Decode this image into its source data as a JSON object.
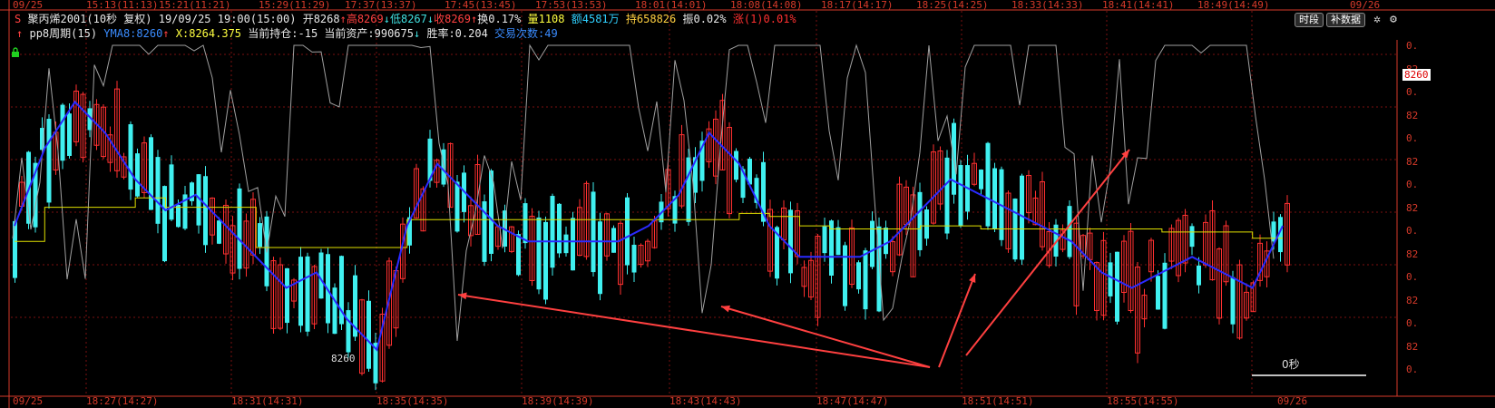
{
  "top_axis": {
    "labels": [
      "09/25",
      "15:13(11:13)",
      "15:21(11:21)",
      "15:29(11:29)",
      "17:37(13:37)",
      "17:45(13:45)",
      "17:53(13:53)",
      "18:01(14:01)",
      "18:08(14:08)",
      "18:17(14:17)",
      "18:25(14:25)",
      "18:33(14:33)",
      "18:41(14:41)",
      "18:49(14:49)",
      "09/26"
    ]
  },
  "bottom_axis": {
    "labels": [
      "09/25",
      "18:27(14:27)",
      "18:31(14:31)",
      "18:35(14:35)",
      "18:39(14:39)",
      "18:43(14:43)",
      "18:47(14:47)",
      "18:51(14:51)",
      "18:55(14:55)",
      "09/26"
    ]
  },
  "quote": {
    "icon_letter": "S",
    "name": "聚丙烯2001(10秒 复权)",
    "datetime": "19/09/25 19:00(15:00)",
    "open_label": "开8268",
    "high_label": "高8269",
    "low_label": "低8267",
    "close_label": "收8269",
    "turnover_label": "换0.17%",
    "volume_label": "量1108",
    "amount_label": "额4581万",
    "hold_label": "持658826",
    "amplitude_label": "振0.02%",
    "change_label": "涨(1)0.01%"
  },
  "indicator": {
    "name": "pp8周期(15)",
    "yma_label": "YMA8:8260",
    "x_label": "X:8264.375",
    "position_label": "当前持仓:-15",
    "assets_label": "当前资产:990675",
    "winrate_label": "胜率:0.204",
    "trades_label": "交易次数:49"
  },
  "toolbar": {
    "period_button": "时段",
    "fill_button": "补数据",
    "gear_icon": "gear-icon",
    "settings_icon": "settings-icon"
  },
  "right_axis": {
    "labels": [
      "0.",
      "82",
      "0.",
      "82",
      "0.",
      "82",
      "0.",
      "82",
      "0.",
      "82",
      "0.",
      "82",
      "0.",
      "82",
      "0."
    ],
    "price_tag": "8260"
  },
  "chart_labels": {
    "seconds_label": "0秒",
    "min_label": "8260"
  },
  "colors": {
    "up_bar": "#ff3030",
    "down_bar": "#40f0f0",
    "yma_line": "#2a2aff",
    "x_line": "#e0e000",
    "gray_line": "#a0a0a0",
    "arrow": "#ff4040",
    "axis": "#d63a2a"
  },
  "chart_data": {
    "type": "line",
    "series": [
      {
        "name": "YMA8",
        "values": [
          8263,
          8265.5,
          8267,
          8266,
          8264.5,
          8263.5,
          8264,
          8263,
          8262,
          8261,
          8261.5,
          8260,
          8259,
          8263,
          8265,
          8264,
          8263,
          8262.5,
          8262.5,
          8262.5,
          8262.5,
          8263,
          8264,
          8266,
          8265,
          8263,
          8262,
          8262,
          8262,
          8262.5,
          8263.5,
          8264.5,
          8264,
          8263.5,
          8263,
          8262.5,
          8261.5,
          8261,
          8261.5,
          8262,
          8261.5,
          8261,
          8263
        ]
      },
      {
        "name": "X",
        "values": [
          8262.5,
          8263.6,
          8263.6,
          8263.6,
          8263.9,
          8263.6,
          8263.6,
          8263.6,
          8262.3,
          8262.3,
          8262.3,
          8262.3,
          8262.3,
          8263.2,
          8263.2,
          8263.2,
          8263.2,
          8263.2,
          8263.2,
          8263.2,
          8263.2,
          8263.2,
          8263.2,
          8263.2,
          8263.4,
          8263.3,
          8263.0,
          8262.9,
          8262.9,
          8262.9,
          8263.0,
          8263.0,
          8262.9,
          8262.9,
          8262.9,
          8262.9,
          8262.9,
          8262.9,
          8262.8,
          8262.8,
          8262.8,
          8262.6,
          8262.6
        ]
      }
    ],
    "ylim": [
      8258,
      8269
    ]
  }
}
